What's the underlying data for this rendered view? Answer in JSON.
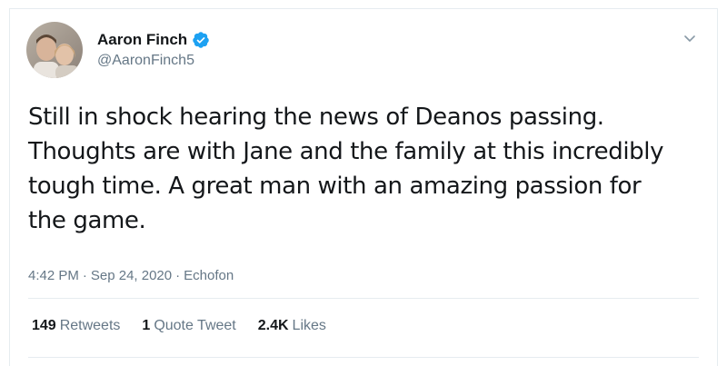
{
  "author": {
    "name": "Aaron Finch",
    "handle": "@AaronFinch5",
    "verified": true
  },
  "tweet": {
    "text": "Still in shock hearing the news of Deanos passing.\nThoughts are with Jane and the family at this incredibly\ntough time. A great man with an amazing passion for\nthe game.",
    "time": "4:42 PM",
    "date": "Sep 24, 2020",
    "source": "Echofon",
    "separator": "·"
  },
  "stats": {
    "retweets_count": "149",
    "retweets_label": "Retweets",
    "quotes_count": "1",
    "quotes_label": "Quote Tweet",
    "likes_count": "2.4K",
    "likes_label": "Likes"
  },
  "colors": {
    "verified_blue": "#1da1f2",
    "secondary_text": "#657786",
    "primary_text": "#14171a",
    "divider": "#e6ecf0"
  },
  "icons": {
    "verified": "verified-badge-icon",
    "menu": "chevron-down-icon"
  }
}
